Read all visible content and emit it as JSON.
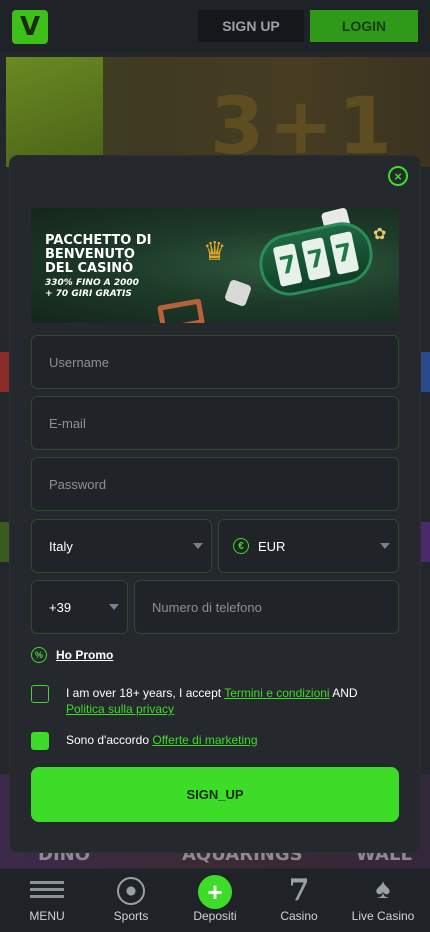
{
  "header": {
    "logo_text": "V",
    "signup_label": "SIGN UP",
    "login_label": "LOGIN"
  },
  "background": {
    "hero_text": "3+1",
    "bottom_labels": [
      "DINO",
      "AQUARINGS",
      "WALL"
    ]
  },
  "modal": {
    "close_symbol": "×",
    "banner": {
      "title": "PACCHETTO DI\nBENVENUTO\nDEL CASINÒ",
      "subtitle": "330% FINO A 2000\n+ 70 GIRI GRATIS",
      "slot_reels": [
        "7",
        "7",
        "7"
      ]
    },
    "fields": {
      "username_placeholder": "Username",
      "email_placeholder": "E-mail",
      "password_placeholder": "Password",
      "country_value": "Italy",
      "currency_icon": "€",
      "currency_value": "EUR",
      "phone_prefix": "+39",
      "phone_placeholder": "Numero di telefono"
    },
    "promo": {
      "icon": "%",
      "label": "Ho Promo"
    },
    "age_consent": {
      "checked": false,
      "text_before": "I am over 18+ years, I accept ",
      "terms_link": "Termini e condizioni",
      "text_and": " AND",
      "privacy_link": "Politica sulla privacy"
    },
    "marketing_consent": {
      "checked": true,
      "text_before": "Sono d'accordo ",
      "marketing_link": "Offerte di marketing"
    },
    "submit_label": "SIGN_UP"
  },
  "bottom_nav": {
    "items": [
      {
        "label": "MENU",
        "icon": "menu-icon"
      },
      {
        "label": "Sports",
        "icon": "soccer-ball-icon"
      },
      {
        "label": "Depositi",
        "icon": "plus-icon",
        "symbol": "+"
      },
      {
        "label": "Casino",
        "icon": "seven-icon",
        "symbol": "7"
      },
      {
        "label": "Live Casino",
        "icon": "spade-icon",
        "symbol": "♠"
      }
    ]
  },
  "colors": {
    "accent": "#3ddc28",
    "background": "#1a1d22",
    "modal": "#25282d"
  }
}
